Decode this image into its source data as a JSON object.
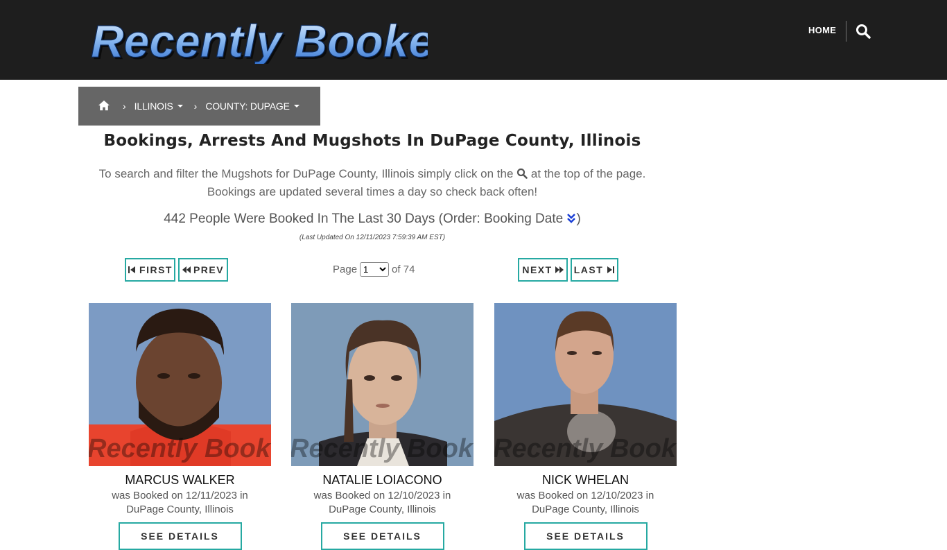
{
  "header": {
    "logo_text": "Recently Booked",
    "nav_home": "HOME"
  },
  "breadcrumb": {
    "state": "ILLINOIS",
    "county": "COUNTY: DUPAGE"
  },
  "main": {
    "title": "Bookings, Arrests And Mugshots In DuPage County, Illinois",
    "intro_part1": "To search and filter the Mugshots for DuPage County, Illinois simply click on the",
    "intro_part2": "at the top of the page.",
    "intro_line2": "Bookings are updated several times a day so check back often!",
    "count_text": "442 People Were Booked In The Last 30 Days (Order: Booking Date",
    "count_close": ")",
    "updated": "(Last Updated On 12/11/2023 7:59:39 AM EST)"
  },
  "pagination": {
    "first": "FIRST",
    "prev": "PREV",
    "next": "NEXT",
    "last": "LAST",
    "page_label": "Page",
    "current_page": "1",
    "of_label": "of 74"
  },
  "colors": {
    "header_bg": "#1e1e1e",
    "breadcrumb_bg": "#666666",
    "accent": "#26a9a2",
    "watermark": "Recently Booked.com"
  },
  "cards": [
    {
      "name": "MARCUS WALKER",
      "line1": "was Booked on 12/11/2023 in",
      "line2": "DuPage County, Illinois",
      "button": "SEE DETAILS"
    },
    {
      "name": "NATALIE LOIACONO",
      "line1": "was Booked on 12/10/2023 in",
      "line2": "DuPage County, Illinois",
      "button": "SEE DETAILS"
    },
    {
      "name": "NICK WHELAN",
      "line1": "was Booked on 12/10/2023 in",
      "line2": "DuPage County, Illinois",
      "button": "SEE DETAILS"
    }
  ]
}
